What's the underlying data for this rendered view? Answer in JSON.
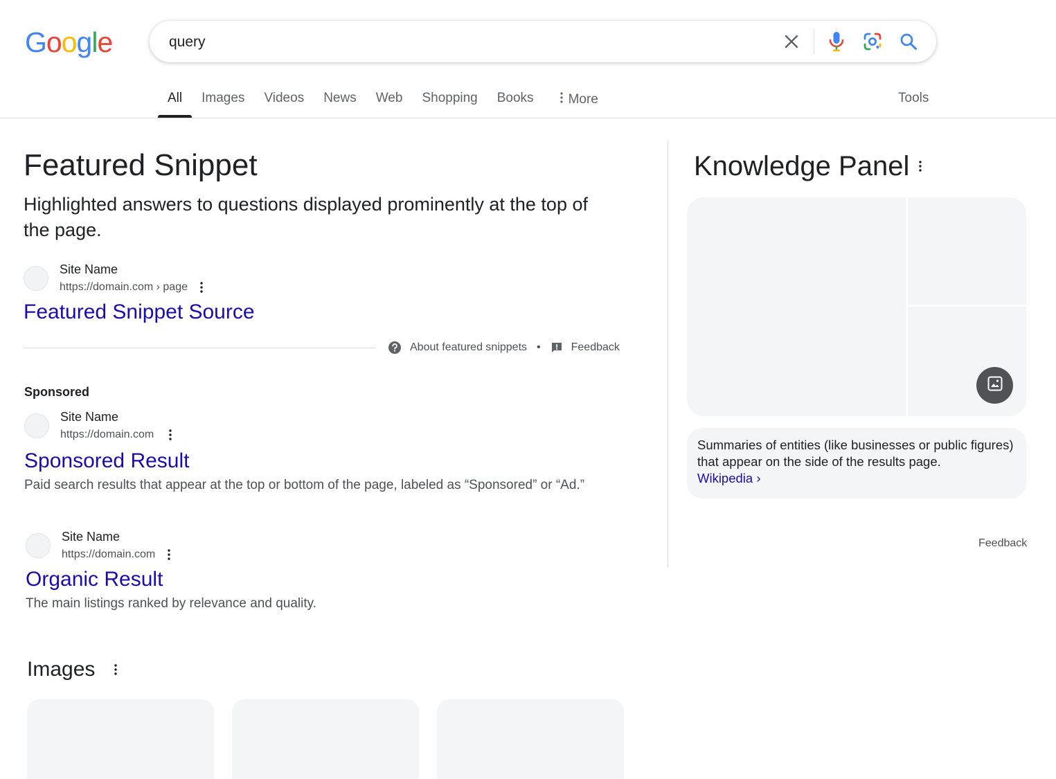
{
  "header": {
    "logo_letters": [
      {
        "char": "G",
        "color": "#4285F4"
      },
      {
        "char": "o",
        "color": "#EA4335"
      },
      {
        "char": "o",
        "color": "#FBBC05"
      },
      {
        "char": "g",
        "color": "#4285F4"
      },
      {
        "char": "l",
        "color": "#34A853"
      },
      {
        "char": "e",
        "color": "#EA4335"
      }
    ],
    "search": {
      "value": "query",
      "icons": [
        "close-icon",
        "mic-icon",
        "lens-icon",
        "search-icon"
      ]
    }
  },
  "tabs": {
    "items": [
      "All",
      "Images",
      "Videos",
      "News",
      "Web",
      "Shopping",
      "Books"
    ],
    "active": "All",
    "more_label": "More",
    "tools_label": "Tools"
  },
  "featured_snippet": {
    "heading": "Featured Snippet",
    "description": "Highlighted answers to questions displayed prominently at the top of the page.",
    "site_name": "Site Name",
    "site_url": "https://domain.com › page",
    "title": "Featured Snippet Source",
    "footer_about": "About featured snippets",
    "footer_separator": "•",
    "footer_feedback": "Feedback"
  },
  "sponsored": {
    "label": "Sponsored",
    "site_name": "Site Name",
    "site_url": "https://domain.com",
    "title": "Sponsored Result",
    "snippet": "Paid search results that appear at the top or bottom of the page, labeled as “Sponsored” or “Ad.”"
  },
  "organic": {
    "site_name": "Site Name",
    "site_url": "https://domain.com",
    "title": "Organic Result",
    "snippet": "The main listings ranked by relevance and quality."
  },
  "images_section": {
    "heading": "Images",
    "card_count": 3
  },
  "knowledge_panel": {
    "heading": "Knowledge Panel",
    "description": "Summaries of entities (like businesses or public figures) that appear on the side of the results page.",
    "link": "Wikipedia ›",
    "feedback": "Feedback"
  },
  "colors": {
    "link": "#1a0dab",
    "text": "#202124",
    "secondary": "#4d5156",
    "tab_text": "#5f6368",
    "placeholder_bg": "#f4f5f6",
    "lens_blue": "#4285F4",
    "lens_red": "#EA4335",
    "lens_yellow": "#FBBC05",
    "lens_green": "#34A853"
  }
}
